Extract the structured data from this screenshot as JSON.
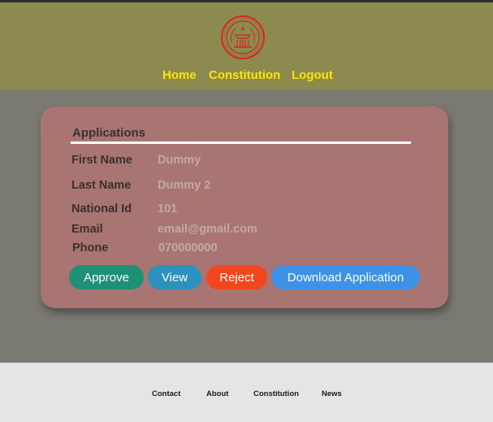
{
  "header": {
    "logo_icon": "seal-logo-icon",
    "logo_color": "#d8261a",
    "nav": {
      "home": "Home",
      "constitution": "Constitution",
      "logout": "Logout"
    }
  },
  "card": {
    "title": "Applications",
    "fields": {
      "first_name": {
        "label": "First Name",
        "value": "Dummy"
      },
      "last_name": {
        "label": "Last Name",
        "value": "Dummy 2"
      },
      "national_id": {
        "label": "National Id",
        "value": "101"
      },
      "email": {
        "label": "Email",
        "value": "email@gmail.com"
      },
      "phone": {
        "label": "Phone",
        "value": "070000000"
      }
    },
    "buttons": {
      "approve": "Approve",
      "view": "View",
      "reject": "Reject",
      "download": "Download Application"
    }
  },
  "footer": {
    "contact": "Contact",
    "about": "About",
    "constitution": "Constitution",
    "news": "News"
  },
  "colors": {
    "header_bg": "#8c8a4f",
    "nav_text": "#ffe600",
    "card_bg": "#a87572",
    "approve": "#1d9077",
    "view": "#2b91bd",
    "reject": "#f2471e",
    "download": "#3d92e8"
  }
}
